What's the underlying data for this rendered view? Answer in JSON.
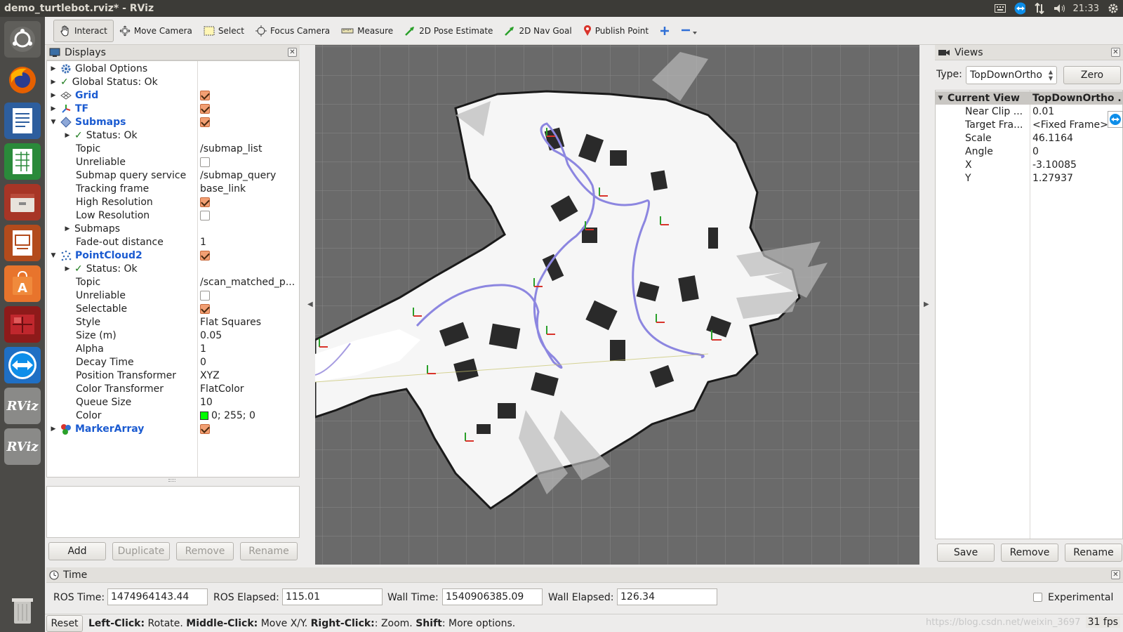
{
  "window": {
    "title": "demo_turtlebot.rviz* - RViz",
    "clock": "21:33"
  },
  "launcher": {
    "items": [
      "ubuntu-dash",
      "firefox",
      "libreoffice-writer",
      "libreoffice-calc",
      "files",
      "libreoffice-impress",
      "software-center",
      "system-monitor",
      "teamviewer",
      "rviz",
      "rviz"
    ],
    "rviz_label": "RViz"
  },
  "toolbar": {
    "interact": "Interact",
    "move_camera": "Move Camera",
    "select": "Select",
    "focus_camera": "Focus Camera",
    "measure": "Measure",
    "pose_estimate": "2D Pose Estimate",
    "nav_goal": "2D Nav Goal",
    "publish_point": "Publish Point"
  },
  "displays": {
    "title": "Displays",
    "rows": [
      {
        "label": "Global Options",
        "value": ""
      },
      {
        "label": "Global Status: Ok",
        "value": ""
      },
      {
        "label": "Grid",
        "value": ""
      },
      {
        "label": "TF",
        "value": ""
      },
      {
        "label": "Submaps",
        "value": ""
      },
      {
        "label": "Status: Ok",
        "value": ""
      },
      {
        "label": "Topic",
        "value": "/submap_list"
      },
      {
        "label": "Unreliable",
        "value": ""
      },
      {
        "label": "Submap query service",
        "value": "/submap_query"
      },
      {
        "label": "Tracking frame",
        "value": "base_link"
      },
      {
        "label": "High Resolution",
        "value": ""
      },
      {
        "label": "Low Resolution",
        "value": ""
      },
      {
        "label": "Submaps",
        "value": ""
      },
      {
        "label": "Fade-out distance",
        "value": "1"
      },
      {
        "label": "PointCloud2",
        "value": ""
      },
      {
        "label": "Status: Ok",
        "value": ""
      },
      {
        "label": "Topic",
        "value": "/scan_matched_p..."
      },
      {
        "label": "Unreliable",
        "value": ""
      },
      {
        "label": "Selectable",
        "value": ""
      },
      {
        "label": "Style",
        "value": "Flat Squares"
      },
      {
        "label": "Size (m)",
        "value": "0.05"
      },
      {
        "label": "Alpha",
        "value": "1"
      },
      {
        "label": "Decay Time",
        "value": "0"
      },
      {
        "label": "Position Transformer",
        "value": "XYZ"
      },
      {
        "label": "Color Transformer",
        "value": "FlatColor"
      },
      {
        "label": "Queue Size",
        "value": "10"
      },
      {
        "label": "Color",
        "value": "0; 255; 0"
      },
      {
        "label": "MarkerArray",
        "value": ""
      }
    ],
    "buttons": {
      "add": "Add",
      "duplicate": "Duplicate",
      "remove": "Remove",
      "rename": "Rename"
    }
  },
  "views": {
    "title": "Views",
    "type_label": "Type:",
    "type_value": "TopDownOrtho",
    "zero": "Zero",
    "header": {
      "name": "Current View",
      "value": "TopDownOrtho ..."
    },
    "rows": [
      {
        "label": "Near Clip ...",
        "value": "0.01"
      },
      {
        "label": "Target Fra...",
        "value": "<Fixed Frame>"
      },
      {
        "label": "Scale",
        "value": "46.1164"
      },
      {
        "label": "Angle",
        "value": "0"
      },
      {
        "label": "X",
        "value": "-3.10085"
      },
      {
        "label": "Y",
        "value": "1.27937"
      }
    ],
    "buttons": {
      "save": "Save",
      "remove": "Remove",
      "rename": "Rename"
    }
  },
  "time": {
    "title": "Time",
    "ros_time_label": "ROS Time:",
    "ros_time": "1474964143.44",
    "ros_elapsed_label": "ROS Elapsed:",
    "ros_elapsed": "115.01",
    "wall_time_label": "Wall Time:",
    "wall_time": "1540906385.09",
    "wall_elapsed_label": "Wall Elapsed:",
    "wall_elapsed": "126.34",
    "experimental": "Experimental"
  },
  "status": {
    "reset": "Reset",
    "k1": "Left-Click:",
    "t1": " Rotate. ",
    "k2": "Middle-Click:",
    "t2": " Move X/Y. ",
    "k3": "Right-Click:",
    "t3": ": Zoom. ",
    "k4": "Shift",
    "t4": ": More options.",
    "watermark": "https://blog.csdn.net/weixin_3697",
    "fps": "31 fps"
  },
  "colors": {
    "accent_blue": "#1b5bd1",
    "trajectory": "#8c86e0",
    "check_orange": "#f29f73",
    "pointcloud_color": "#00ff00"
  }
}
